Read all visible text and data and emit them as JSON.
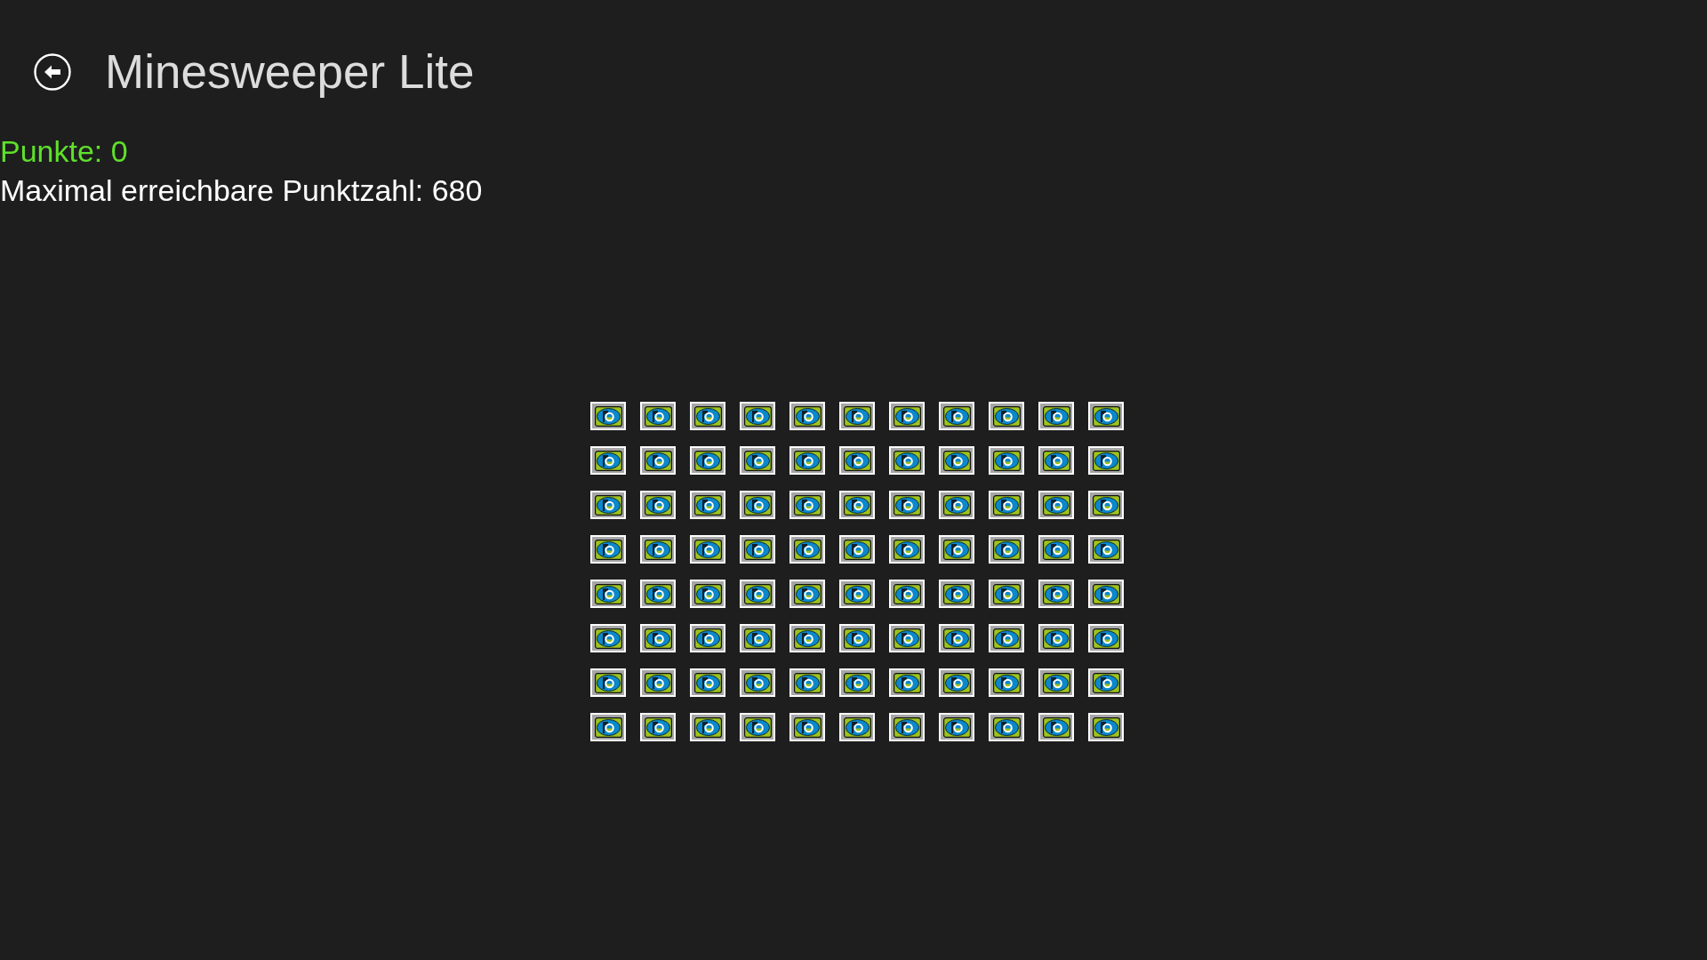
{
  "header": {
    "title": "Minesweeper Lite"
  },
  "score": {
    "points": "Punkte: 0",
    "max_points": "Maximal erreichbare Punktzahl: 680"
  },
  "board": {
    "rows": [
      {
        "cells": [
          {
            "kind": "covered"
          },
          {
            "kind": "covered"
          },
          {
            "kind": "covered"
          },
          {
            "kind": "covered"
          },
          {
            "kind": "covered"
          },
          {
            "kind": "covered"
          },
          {
            "kind": "covered"
          },
          {
            "kind": "covered"
          },
          {
            "kind": "covered"
          },
          {
            "kind": "covered"
          },
          {
            "kind": "covered"
          }
        ]
      },
      {
        "cells": [
          {
            "kind": "covered"
          },
          {
            "kind": "covered"
          },
          {
            "kind": "covered"
          },
          {
            "kind": "covered"
          },
          {
            "kind": "covered"
          },
          {
            "kind": "covered"
          },
          {
            "kind": "covered"
          },
          {
            "kind": "covered"
          },
          {
            "kind": "covered"
          },
          {
            "kind": "covered"
          },
          {
            "kind": "covered"
          }
        ]
      },
      {
        "cells": [
          {
            "kind": "covered"
          },
          {
            "kind": "covered"
          },
          {
            "kind": "covered"
          },
          {
            "kind": "covered"
          },
          {
            "kind": "covered"
          },
          {
            "kind": "covered"
          },
          {
            "kind": "covered"
          },
          {
            "kind": "covered"
          },
          {
            "kind": "covered"
          },
          {
            "kind": "covered"
          },
          {
            "kind": "covered"
          }
        ]
      },
      {
        "cells": [
          {
            "kind": "covered"
          },
          {
            "kind": "covered"
          },
          {
            "kind": "covered"
          },
          {
            "kind": "covered"
          },
          {
            "kind": "covered"
          },
          {
            "kind": "covered"
          },
          {
            "kind": "covered"
          },
          {
            "kind": "covered"
          },
          {
            "kind": "covered"
          },
          {
            "kind": "covered"
          },
          {
            "kind": "covered"
          }
        ]
      },
      {
        "cells": [
          {
            "kind": "covered"
          },
          {
            "kind": "covered"
          },
          {
            "kind": "covered"
          },
          {
            "kind": "covered"
          },
          {
            "kind": "covered"
          },
          {
            "kind": "covered"
          },
          {
            "kind": "covered"
          },
          {
            "kind": "covered"
          },
          {
            "kind": "covered"
          },
          {
            "kind": "covered"
          },
          {
            "kind": "covered"
          }
        ]
      },
      {
        "cells": [
          {
            "kind": "covered"
          },
          {
            "kind": "covered"
          },
          {
            "kind": "covered"
          },
          {
            "kind": "covered"
          },
          {
            "kind": "covered"
          },
          {
            "kind": "covered"
          },
          {
            "kind": "covered"
          },
          {
            "kind": "covered"
          },
          {
            "kind": "covered"
          },
          {
            "kind": "covered"
          },
          {
            "kind": "covered"
          }
        ]
      },
      {
        "cells": [
          {
            "kind": "covered"
          },
          {
            "kind": "covered"
          },
          {
            "kind": "covered"
          },
          {
            "kind": "covered"
          },
          {
            "kind": "covered"
          },
          {
            "kind": "covered"
          },
          {
            "kind": "covered"
          },
          {
            "kind": "covered"
          },
          {
            "kind": "covered"
          },
          {
            "kind": "covered"
          },
          {
            "kind": "covered"
          }
        ]
      },
      {
        "cells": [
          {
            "kind": "covered"
          },
          {
            "kind": "covered"
          },
          {
            "kind": "covered"
          },
          {
            "kind": "covered"
          },
          {
            "kind": "covered"
          },
          {
            "kind": "covered"
          },
          {
            "kind": "covered"
          },
          {
            "kind": "covered"
          },
          {
            "kind": "covered"
          },
          {
            "kind": "covered"
          },
          {
            "kind": "covered"
          }
        ]
      }
    ]
  }
}
